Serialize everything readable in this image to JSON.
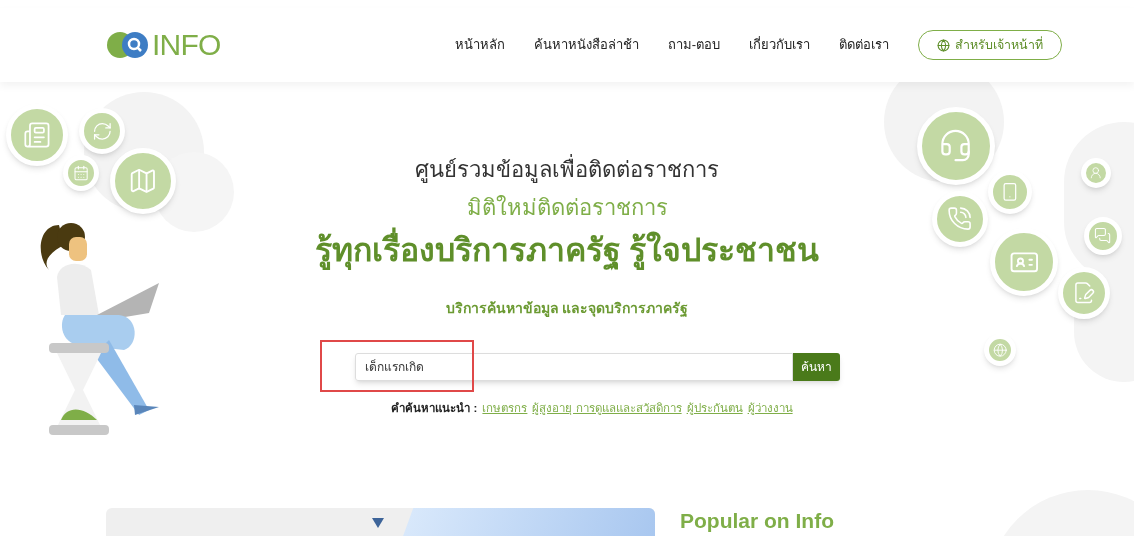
{
  "header": {
    "logo": "INFO",
    "nav": [
      {
        "label": "หน้าหลัก"
      },
      {
        "label": "ค้นหาหนังสือล่าช้า"
      },
      {
        "label": "ถาม-ตอบ"
      },
      {
        "label": "เกี่ยวกับเรา"
      },
      {
        "label": "ติดต่อเรา"
      }
    ],
    "staff_button": "สำหรับเจ้าหน้าที่"
  },
  "hero": {
    "line_1": "ศูนย์รวมข้อมูลเพื่อติดต่อราชการ",
    "line_2": "มิติใหม่ติดต่อราชการ",
    "headline": "รู้ทุกเรื่องบริการภาครัฐ รู้ใจประชาชน",
    "subtitle": "บริการค้นหาข้อมูล และจุดบริการภาครัฐ"
  },
  "search": {
    "value": "เด็กแรกเกิด",
    "button": "ค้นหา",
    "highlighted": true
  },
  "suggestions": {
    "label": "คำค้นหาแนะนำ :",
    "links": [
      "เกษตรกร",
      "ผู้สูงอายุ การดูแลและสวัสดิการ",
      "ผู้ประกันตน",
      "ผู้ว่างงาน"
    ]
  },
  "popular": {
    "title": "Popular on Info"
  }
}
